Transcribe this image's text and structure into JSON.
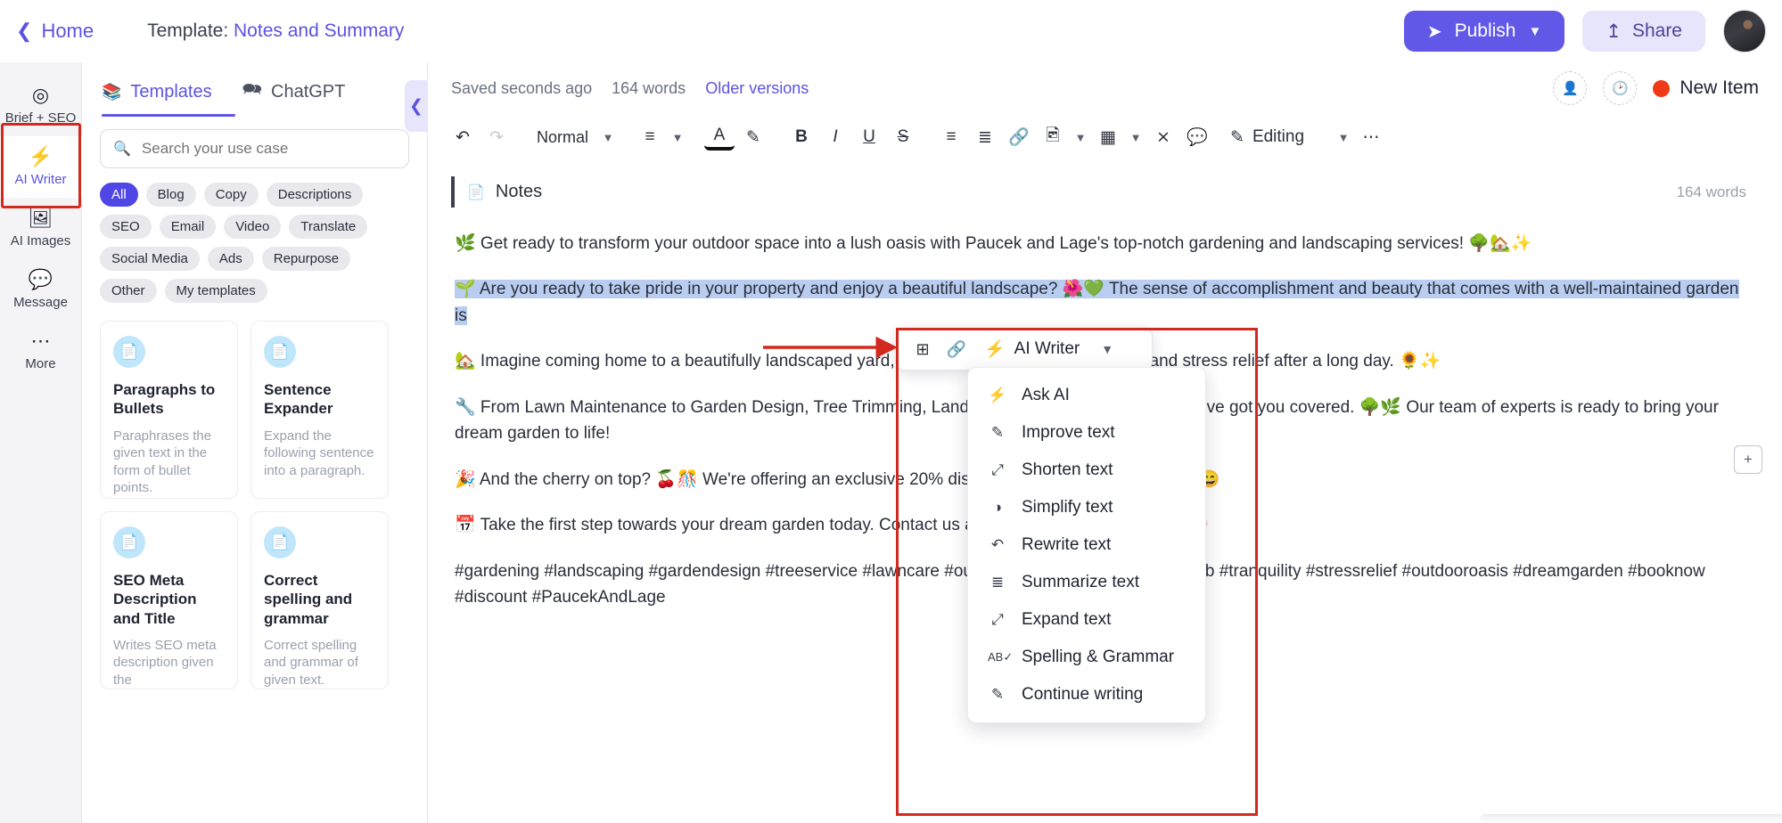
{
  "topbar": {
    "home_label": "Home",
    "template_prefix": "Template:",
    "template_name": "Notes and Summary",
    "publish_label": "Publish",
    "share_label": "Share",
    "send_icon": "send-icon",
    "upload_icon": "upload-icon",
    "chevron_icon": "chevron-down-icon",
    "avatar_icon": "user-avatar"
  },
  "rail": {
    "items": [
      {
        "label": "Brief + SEO",
        "icon": "target-icon",
        "active": false
      },
      {
        "label": "AI Writer",
        "icon": "lightning-icon",
        "active": true
      },
      {
        "label": "AI Images",
        "icon": "image-icon",
        "active": false
      },
      {
        "label": "Message",
        "icon": "chat-icon",
        "active": false
      },
      {
        "label": "More",
        "icon": "ellipsis-icon",
        "active": false
      }
    ]
  },
  "panel": {
    "tabs": [
      {
        "label": "Templates",
        "icon": "books-icon",
        "active": true
      },
      {
        "label": "ChatGPT",
        "icon": "chat-bubbles-icon",
        "active": false
      }
    ],
    "search": {
      "placeholder": "Search your use case",
      "value": "",
      "icon": "search-icon"
    },
    "chips": [
      {
        "label": "All",
        "selected": true
      },
      {
        "label": "Blog",
        "selected": false
      },
      {
        "label": "Copy",
        "selected": false
      },
      {
        "label": "Descriptions",
        "selected": false
      },
      {
        "label": "SEO",
        "selected": false
      },
      {
        "label": "Email",
        "selected": false
      },
      {
        "label": "Video",
        "selected": false
      },
      {
        "label": "Translate",
        "selected": false
      },
      {
        "label": "Social Media",
        "selected": false
      },
      {
        "label": "Ads",
        "selected": false
      },
      {
        "label": "Repurpose",
        "selected": false
      },
      {
        "label": "Other",
        "selected": false
      },
      {
        "label": "My templates",
        "selected": false
      }
    ],
    "cards": [
      {
        "title": "Paragraphs to Bullets",
        "desc": "Paraphrases the given text in the form of bullet points.",
        "icon": "document-icon"
      },
      {
        "title": "Sentence Expander",
        "desc": "Expand the following sentence into a paragraph.",
        "icon": "document-icon"
      },
      {
        "title": "SEO Meta Description and Title",
        "desc": "Writes SEO meta description given the",
        "icon": "document-icon"
      },
      {
        "title": "Correct spelling and grammar",
        "desc": "Correct spelling and grammar of given text.",
        "icon": "document-icon"
      }
    ],
    "collapse_icon": "chevron-left-icon"
  },
  "editor": {
    "saved_status": "Saved seconds ago",
    "word_count": "164 words",
    "older_versions": "Older versions",
    "invite_icon": "add-person-icon",
    "history_icon": "history-icon",
    "new_item_label": "New Item",
    "toolbar": {
      "undo": "undo-icon",
      "redo": "redo-icon",
      "style": "Normal",
      "style_caret": "chevron-down-icon",
      "align": "align-icon",
      "align_caret": "chevron-down-icon",
      "text_color": "A",
      "highlight": "highlighter-icon",
      "bold": "B",
      "italic": "I",
      "underline": "U",
      "strike": "S",
      "bullet_list": "bullet-list-icon",
      "numbered_list": "numbered-list-icon",
      "link": "link-icon",
      "image": "image-icon",
      "image_caret": "chevron-down-icon",
      "table": "table-icon",
      "table_caret": "chevron-down-icon",
      "clear_format": "clear-format-icon",
      "comment": "add-comment-icon",
      "mode_icon": "pencil-icon",
      "mode_label": "Editing",
      "mode_caret": "chevron-down-icon",
      "more": "ellipsis-icon"
    },
    "notes": {
      "icon": "note-icon",
      "title": "Notes",
      "word_count": "164 words"
    },
    "paragraphs": [
      {
        "text": "🌿 Get ready to transform your outdoor space into a lush oasis with Paucek and Lage's top-notch gardening and landscaping services! 🌳🏡✨",
        "selected": false
      },
      {
        "text": "🌱 Are you ready to take pride in your property and enjoy a beautiful landscape? 🌺💚 The sense of accomplishment and beauty that comes with a well-maintained garden is",
        "selected": true
      },
      {
        "text": "🏡 Imagine coming home to a beautifully landscaped yard, a sanctuary that offers relaxation and stress relief after a long day. 🌻✨",
        "selected": false
      },
      {
        "text": "🔧 From Lawn Maintenance to Garden Design, Tree Trimming, Landscape Design, and Mowing, we've got you covered. 🌳🌿 Our team of experts is ready to bring your dream garden to life!",
        "selected": false
      },
      {
        "text": "🎉 And the cherry on top? 🍒🎊 We're offering an exclusive 20% discount on your first booking! 💰😄",
        "selected": false
      },
      {
        "text": "📅 Take the first step towards your dream garden today. Contact us and let us work our magic! ✨🌸",
        "selected": false
      },
      {
        "text": "#gardening #landscaping #gardendesign #treeservice #lawncare #outdoorliving #lemon #greenthumb #tranquility #stressrelief #outdooroasis #dreamgarden #booknow #discount #PaucekAndLage",
        "selected": false
      }
    ],
    "add_block_icon": "add-block-icon"
  },
  "ai_float": {
    "add_icon": "add-block-icon",
    "link_icon": "link-icon",
    "lightning_icon": "lightning-icon",
    "label": "AI Writer",
    "caret_icon": "chevron-down-icon"
  },
  "ai_menu": {
    "items": [
      {
        "label": "Ask AI",
        "icon": "lightning-icon"
      },
      {
        "label": "Improve text",
        "icon": "improve-icon"
      },
      {
        "label": "Shorten text",
        "icon": "shorten-icon"
      },
      {
        "label": "Simplify text",
        "icon": "simplify-icon"
      },
      {
        "label": "Rewrite text",
        "icon": "rewrite-icon"
      },
      {
        "label": "Summarize text",
        "icon": "summarize-icon"
      },
      {
        "label": "Expand text",
        "icon": "expand-icon"
      },
      {
        "label": "Spelling & Grammar",
        "icon": "spellcheck-icon"
      },
      {
        "label": "Continue writing",
        "icon": "pencil-icon"
      }
    ]
  },
  "annotations": {
    "accent_red": "#d2291e",
    "brand_purple": "#6158e8",
    "selection_blue": "#b9cdf0"
  }
}
